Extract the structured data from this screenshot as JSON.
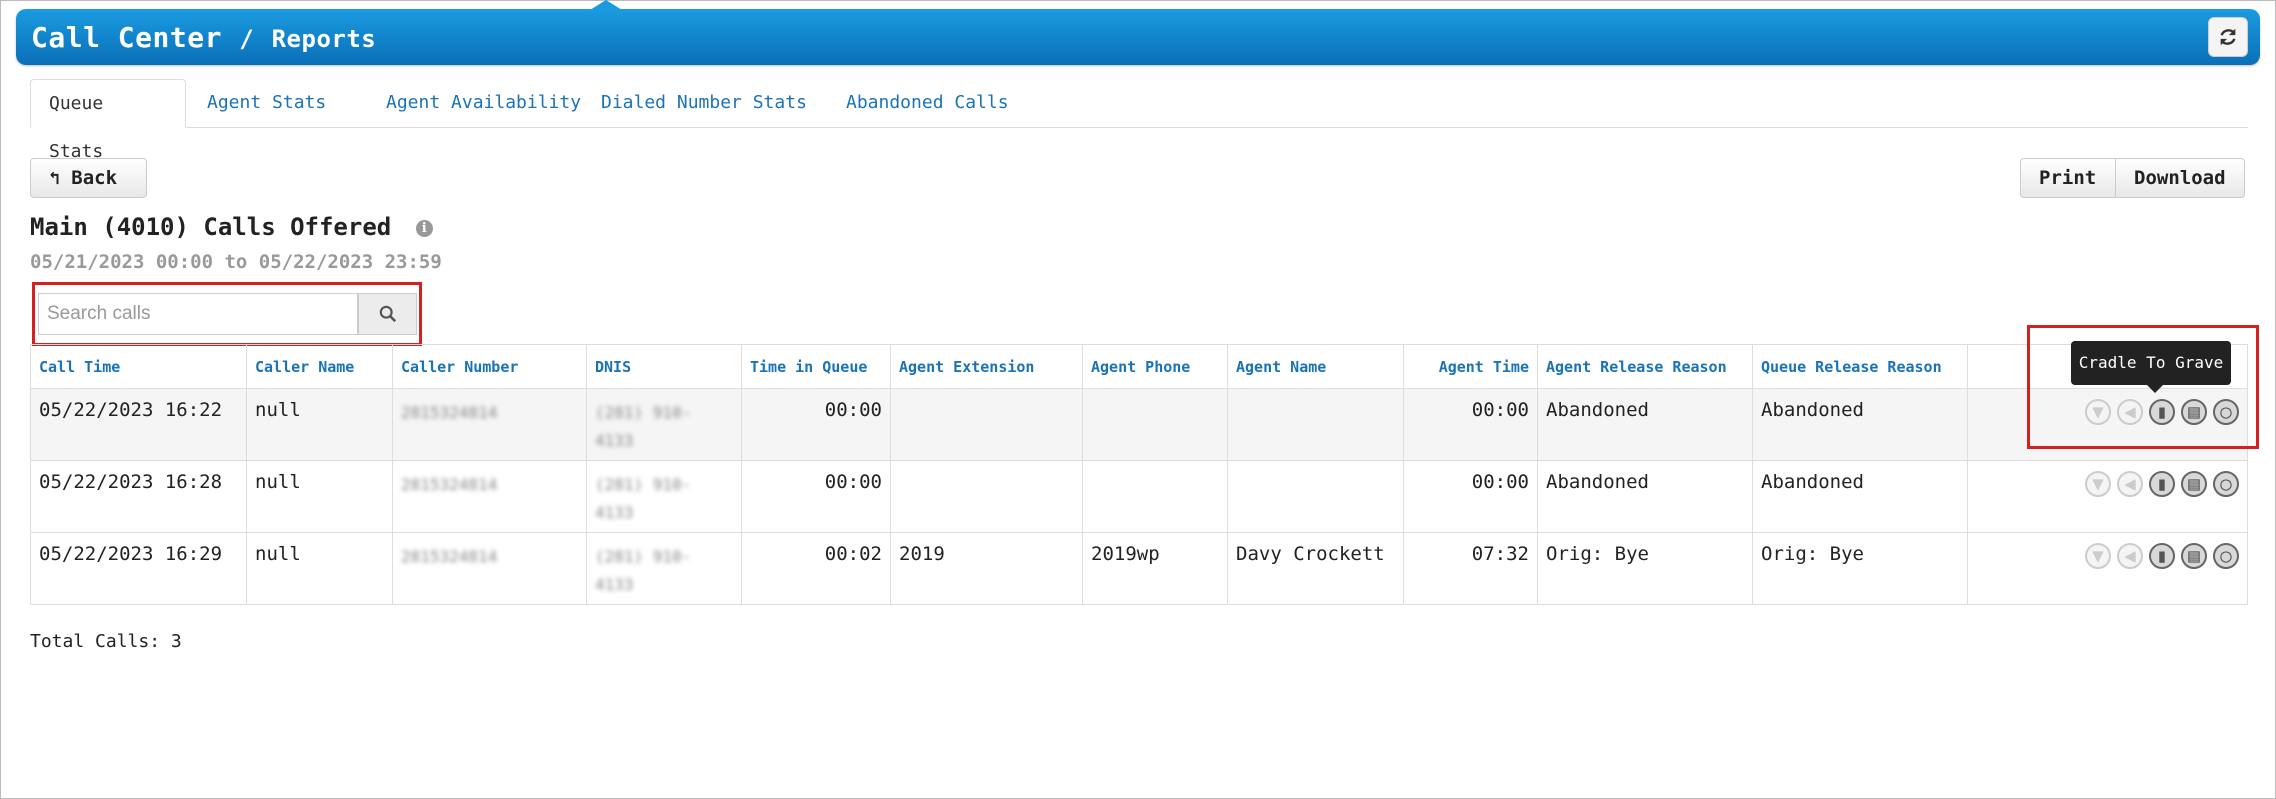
{
  "header": {
    "title": "Call Center",
    "separator": "/",
    "subtitle": "Reports",
    "refresh_icon": "refresh-icon"
  },
  "tabs": [
    {
      "label": "Queue Stats",
      "active": true
    },
    {
      "label": "Agent Stats",
      "active": false
    },
    {
      "label": "Agent Availability",
      "active": false
    },
    {
      "label": "Dialed Number Stats",
      "active": false
    },
    {
      "label": "Abandoned Calls",
      "active": false
    }
  ],
  "toolbar": {
    "back_label": "Back",
    "print_label": "Print",
    "download_label": "Download"
  },
  "report": {
    "title": "Main (4010) Calls Offered",
    "date_range": "05/21/2023 00:00 to 05/22/2023 23:59"
  },
  "search": {
    "placeholder": "Search calls"
  },
  "table": {
    "columns": [
      "Call Time",
      "Caller Name",
      "Caller Number",
      "DNIS",
      "Time in Queue",
      "Agent Extension",
      "Agent Phone",
      "Agent Name",
      "Agent Time",
      "Agent Release Reason",
      "Queue Release Reason"
    ],
    "rows": [
      {
        "call_time": "05/22/2023 16:22",
        "caller_name": "null",
        "caller_number": "2815324814",
        "dnis": "(281) 910-4133",
        "time_in_queue": "00:00",
        "agent_extension": "",
        "agent_phone": "",
        "agent_name": "",
        "agent_time": "00:00",
        "agent_release_reason": "Abandoned",
        "queue_release_reason": "Abandoned"
      },
      {
        "call_time": "05/22/2023 16:28",
        "caller_name": "null",
        "caller_number": "2815324814",
        "dnis": "(281) 910-4133",
        "time_in_queue": "00:00",
        "agent_extension": "",
        "agent_phone": "",
        "agent_name": "",
        "agent_time": "00:00",
        "agent_release_reason": "Abandoned",
        "queue_release_reason": "Abandoned"
      },
      {
        "call_time": "05/22/2023 16:29",
        "caller_name": "null",
        "caller_number": "2815324814",
        "dnis": "(281) 910-4133",
        "time_in_queue": "00:02",
        "agent_extension": "2019",
        "agent_phone": "2019wp",
        "agent_name": "Davy Crockett",
        "agent_time": "07:32",
        "agent_release_reason": "Orig: Bye",
        "queue_release_reason": "Orig: Bye"
      }
    ],
    "row_actions": [
      "download-recording-icon",
      "listen-icon",
      "cradle-to-grave-icon",
      "notes-icon",
      "details-search-icon"
    ]
  },
  "tooltip": {
    "text": "Cradle To Grave"
  },
  "footer": {
    "total_calls": "Total Calls: 3"
  },
  "colors": {
    "header_blue": "#0a7ec9",
    "link_blue": "#1a73b8",
    "highlight_red": "#d42020"
  }
}
